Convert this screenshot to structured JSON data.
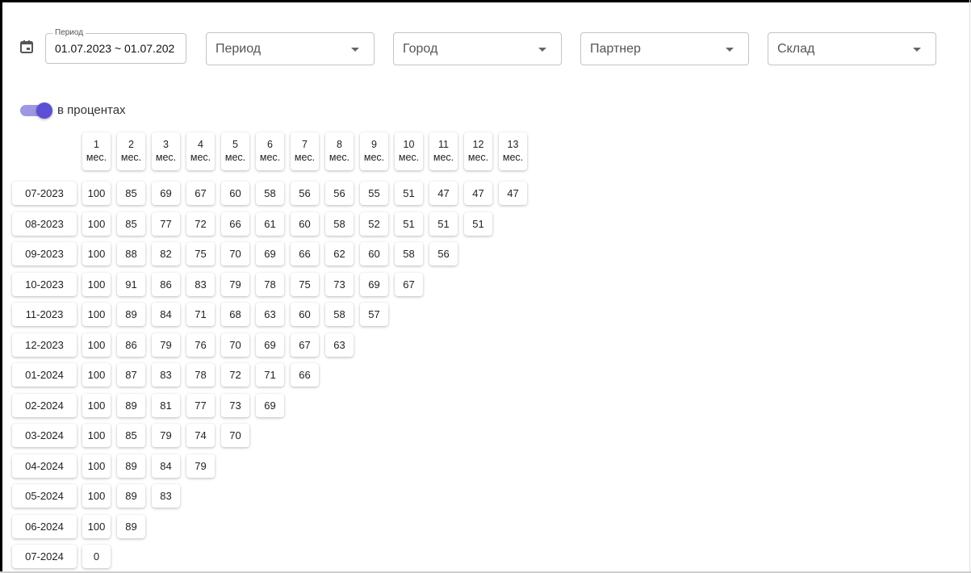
{
  "filters": {
    "date_label": "Период",
    "date_value": "01.07.2023 ~ 01.07.202",
    "period_label": "Период",
    "city_label": "Город",
    "partner_label": "Партнер",
    "warehouse_label": "Склад"
  },
  "toggle": {
    "label": "в процентах",
    "on": true
  },
  "columns": [
    {
      "n": "1",
      "unit": "мес."
    },
    {
      "n": "2",
      "unit": "мес."
    },
    {
      "n": "3",
      "unit": "мес."
    },
    {
      "n": "4",
      "unit": "мес."
    },
    {
      "n": "5",
      "unit": "мес."
    },
    {
      "n": "6",
      "unit": "мес."
    },
    {
      "n": "7",
      "unit": "мес."
    },
    {
      "n": "8",
      "unit": "мес."
    },
    {
      "n": "9",
      "unit": "мес."
    },
    {
      "n": "10",
      "unit": "мес."
    },
    {
      "n": "11",
      "unit": "мес."
    },
    {
      "n": "12",
      "unit": "мес."
    },
    {
      "n": "13",
      "unit": "мес."
    }
  ],
  "rows": [
    {
      "label": "07-2023",
      "values": [
        "100",
        "85",
        "69",
        "67",
        "60",
        "58",
        "56",
        "56",
        "55",
        "51",
        "47",
        "47",
        "47"
      ]
    },
    {
      "label": "08-2023",
      "values": [
        "100",
        "85",
        "77",
        "72",
        "66",
        "61",
        "60",
        "58",
        "52",
        "51",
        "51",
        "51"
      ]
    },
    {
      "label": "09-2023",
      "values": [
        "100",
        "88",
        "82",
        "75",
        "70",
        "69",
        "66",
        "62",
        "60",
        "58",
        "56"
      ]
    },
    {
      "label": "10-2023",
      "values": [
        "100",
        "91",
        "86",
        "83",
        "79",
        "78",
        "75",
        "73",
        "69",
        "67"
      ]
    },
    {
      "label": "11-2023",
      "values": [
        "100",
        "89",
        "84",
        "71",
        "68",
        "63",
        "60",
        "58",
        "57"
      ]
    },
    {
      "label": "12-2023",
      "values": [
        "100",
        "86",
        "79",
        "76",
        "70",
        "69",
        "67",
        "63"
      ]
    },
    {
      "label": "01-2024",
      "values": [
        "100",
        "87",
        "83",
        "78",
        "72",
        "71",
        "66"
      ]
    },
    {
      "label": "02-2024",
      "values": [
        "100",
        "89",
        "81",
        "77",
        "73",
        "69"
      ]
    },
    {
      "label": "03-2024",
      "values": [
        "100",
        "85",
        "79",
        "74",
        "70"
      ]
    },
    {
      "label": "04-2024",
      "values": [
        "100",
        "89",
        "84",
        "79"
      ]
    },
    {
      "label": "05-2024",
      "values": [
        "100",
        "89",
        "83"
      ]
    },
    {
      "label": "06-2024",
      "values": [
        "100",
        "89"
      ]
    },
    {
      "label": "07-2024",
      "values": [
        "0"
      ]
    }
  ]
}
